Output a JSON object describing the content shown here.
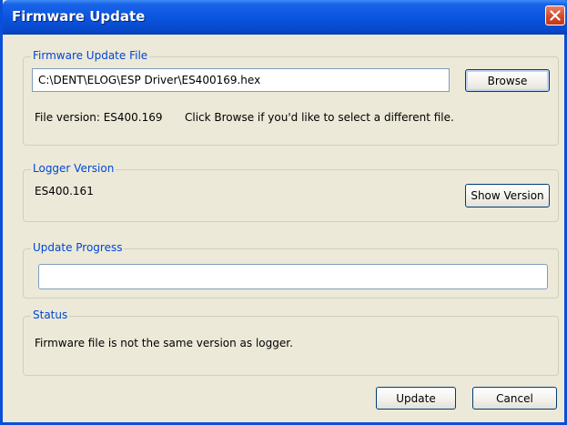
{
  "window": {
    "title": "Firmware Update"
  },
  "firmware_file": {
    "group_label": "Firmware Update File",
    "path": "C:\\DENT\\ELOG\\ESP Driver\\ES400169.hex",
    "browse_label": "Browse",
    "file_version": "File version: ES400.169",
    "hint": "Click Browse if you'd like to select a different file."
  },
  "logger_version": {
    "group_label": "Logger Version",
    "value": "ES400.161",
    "show_version_label": "Show Version"
  },
  "update_progress": {
    "group_label": "Update Progress",
    "fraction": 0
  },
  "status": {
    "group_label": "Status",
    "message": "Firmware file is not the same version as logger."
  },
  "footer": {
    "update_label": "Update",
    "cancel_label": "Cancel"
  },
  "colors": {
    "title_bar": "#0a55e0",
    "group_label": "#0046d5",
    "dialog_background": "#ece9d8",
    "close_button": "#d24a2c"
  },
  "icons": {
    "close": "close-icon"
  }
}
